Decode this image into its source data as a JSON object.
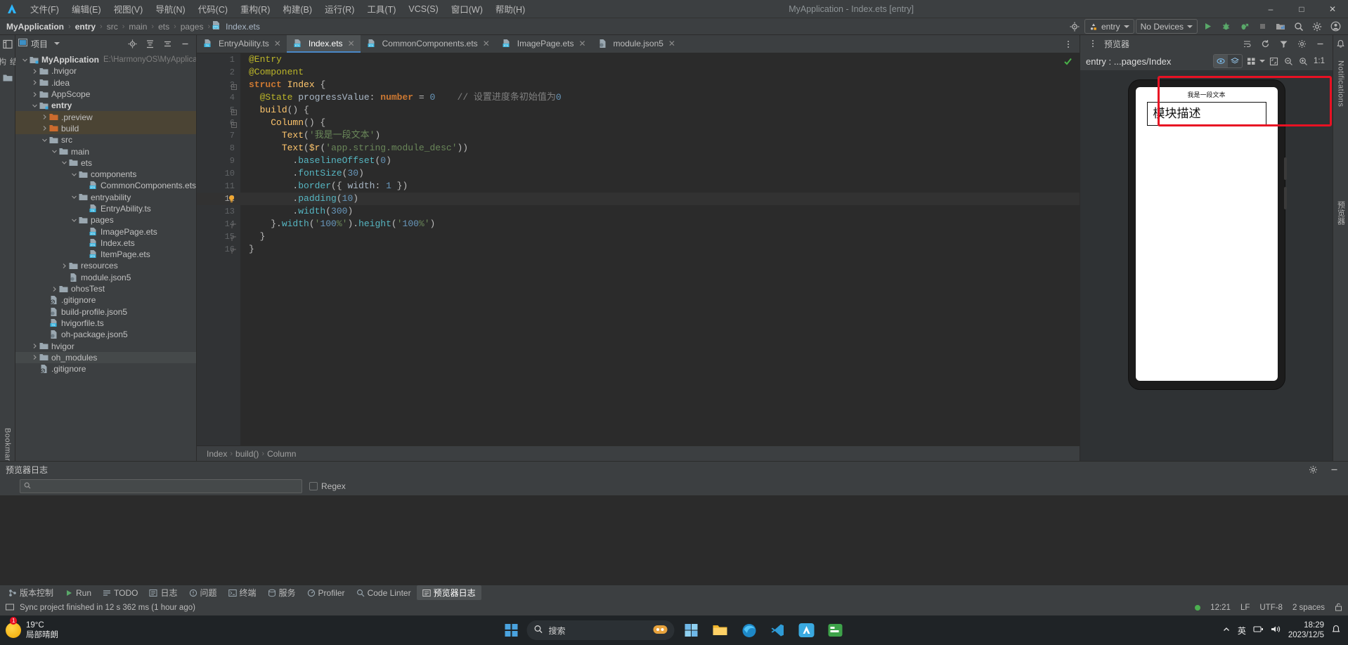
{
  "window": {
    "title": "MyApplication - Index.ets [entry]",
    "minimize": "–",
    "maximize": "□",
    "close": "✕"
  },
  "menubar": {
    "logo_icon": "deveco-logo-icon",
    "items": [
      {
        "label": "文件(F)"
      },
      {
        "label": "编辑(E)"
      },
      {
        "label": "视图(V)"
      },
      {
        "label": "导航(N)"
      },
      {
        "label": "代码(C)"
      },
      {
        "label": "重构(R)"
      },
      {
        "label": "构建(B)"
      },
      {
        "label": "运行(R)"
      },
      {
        "label": "工具(T)"
      },
      {
        "label": "VCS(S)"
      },
      {
        "label": "窗口(W)"
      },
      {
        "label": "帮助(H)"
      }
    ]
  },
  "breadcrumb": {
    "items": [
      "MyApplication",
      "entry",
      "src",
      "main",
      "ets",
      "pages",
      "Index.ets"
    ],
    "separator": "›"
  },
  "navtoolbar": {
    "target_icon": "target-icon",
    "run_config": "entry",
    "device": "No Devices",
    "run_icon": "run-icon",
    "debug_icon": "debug-icon",
    "profile_icon": "run-with-profiler-icon",
    "stop_icon": "stop-icon",
    "device_manager_icon": "device-manager-icon",
    "search_icon": "search-icon",
    "settings_icon": "gear-icon",
    "account_icon": "account-icon"
  },
  "leftstrip": {
    "structure_label": "结构",
    "bookmarks_label": "Bookmarks"
  },
  "project": {
    "panel_title": "项目",
    "dropdown_icon": "chevron-down-icon",
    "locate_icon": "locate-file-icon",
    "expand_icon": "expand-all-icon",
    "collapse_icon": "collapse-all-icon",
    "hide_icon": "hide-panel-icon",
    "root_path": "E:\\HarmonyOS\\MyApplicatio",
    "tree": [
      {
        "label": "MyApplication",
        "depth": 0,
        "arrow": "down",
        "icon": "module-folder",
        "bold": true,
        "path": true
      },
      {
        "label": ".hvigor",
        "depth": 1,
        "arrow": "right",
        "icon": "folder"
      },
      {
        "label": ".idea",
        "depth": 1,
        "arrow": "right",
        "icon": "folder"
      },
      {
        "label": "AppScope",
        "depth": 1,
        "arrow": "right",
        "icon": "folder"
      },
      {
        "label": "entry",
        "depth": 1,
        "arrow": "down",
        "icon": "module-folder",
        "bold": true
      },
      {
        "label": ".preview",
        "depth": 2,
        "arrow": "right",
        "icon": "folder-orange",
        "hl": true
      },
      {
        "label": "build",
        "depth": 2,
        "arrow": "right",
        "icon": "folder-orange",
        "hl": true
      },
      {
        "label": "src",
        "depth": 2,
        "arrow": "down",
        "icon": "folder"
      },
      {
        "label": "main",
        "depth": 3,
        "arrow": "down",
        "icon": "folder"
      },
      {
        "label": "ets",
        "depth": 4,
        "arrow": "down",
        "icon": "folder"
      },
      {
        "label": "components",
        "depth": 5,
        "arrow": "down",
        "icon": "folder"
      },
      {
        "label": "CommonComponents.ets",
        "depth": 6,
        "arrow": "none",
        "icon": "ets-file"
      },
      {
        "label": "entryability",
        "depth": 5,
        "arrow": "down",
        "icon": "folder"
      },
      {
        "label": "EntryAbility.ts",
        "depth": 6,
        "arrow": "none",
        "icon": "ts-file"
      },
      {
        "label": "pages",
        "depth": 5,
        "arrow": "down",
        "icon": "folder"
      },
      {
        "label": "ImagePage.ets",
        "depth": 6,
        "arrow": "none",
        "icon": "ets-file"
      },
      {
        "label": "Index.ets",
        "depth": 6,
        "arrow": "none",
        "icon": "ets-file"
      },
      {
        "label": "ItemPage.ets",
        "depth": 6,
        "arrow": "none",
        "icon": "ets-file"
      },
      {
        "label": "resources",
        "depth": 4,
        "arrow": "right",
        "icon": "folder"
      },
      {
        "label": "module.json5",
        "depth": 4,
        "arrow": "none",
        "icon": "json-file"
      },
      {
        "label": "ohosTest",
        "depth": 3,
        "arrow": "right",
        "icon": "folder"
      },
      {
        "label": ".gitignore",
        "depth": 2,
        "arrow": "none",
        "icon": "gitignore-file"
      },
      {
        "label": "build-profile.json5",
        "depth": 2,
        "arrow": "none",
        "icon": "json-file"
      },
      {
        "label": "hvigorfile.ts",
        "depth": 2,
        "arrow": "none",
        "icon": "ts-file"
      },
      {
        "label": "oh-package.json5",
        "depth": 2,
        "arrow": "none",
        "icon": "json-file"
      },
      {
        "label": "hvigor",
        "depth": 1,
        "arrow": "right",
        "icon": "folder"
      },
      {
        "label": "oh_modules",
        "depth": 1,
        "arrow": "right",
        "icon": "folder",
        "hl2": true
      },
      {
        "label": ".gitignore",
        "depth": 1,
        "arrow": "none",
        "icon": "gitignore-file"
      }
    ]
  },
  "editor": {
    "tabs": [
      {
        "label": "EntryAbility.ts",
        "icon": "ts-file",
        "active": false
      },
      {
        "label": "Index.ets",
        "icon": "ets-file",
        "active": true
      },
      {
        "label": "CommonComponents.ets",
        "icon": "ets-file",
        "active": false
      },
      {
        "label": "ImagePage.ets",
        "icon": "ets-file",
        "active": false
      },
      {
        "label": "module.json5",
        "icon": "json-file",
        "active": false
      }
    ],
    "tab_close": "✕",
    "more_icon": "more-options-icon",
    "inspection_status_icon": "check-ok-icon",
    "current_line": 12,
    "bulb_icon": "intention-bulb-icon",
    "lines": [
      {
        "n": 1,
        "text": "@Entry"
      },
      {
        "n": 2,
        "text": "@Component"
      },
      {
        "n": 3,
        "text": "struct Index {"
      },
      {
        "n": 4,
        "text": "  @State progressValue: number = 0    // 设置进度条初始值为0"
      },
      {
        "n": 5,
        "text": "  build() {"
      },
      {
        "n": 6,
        "text": "    Column() {"
      },
      {
        "n": 7,
        "text": "      Text('我是一段文本')"
      },
      {
        "n": 8,
        "text": "      Text($r('app.string.module_desc'))"
      },
      {
        "n": 9,
        "text": "        .baselineOffset(0)"
      },
      {
        "n": 10,
        "text": "        .fontSize(30)"
      },
      {
        "n": 11,
        "text": "        .border({ width: 1 })"
      },
      {
        "n": 12,
        "text": "        .padding(10)"
      },
      {
        "n": 13,
        "text": "        .width(300)"
      },
      {
        "n": 14,
        "text": "    }.width('100%').height('100%')"
      },
      {
        "n": 15,
        "text": "  }"
      },
      {
        "n": 16,
        "text": "}"
      }
    ],
    "status_breadcrumb": [
      "Index",
      "build()",
      "Column"
    ],
    "status_breadcrumb_sep": "›"
  },
  "preview": {
    "panel_title": "预览器",
    "more_icon": "more-options-icon",
    "route_label": "entry : ...pages/Index",
    "inspector_icon": "inspector-icon",
    "layers_icon": "layers-icon",
    "grid_icon": "multi-device-icon",
    "dropdown_icon": "chevron-down-icon",
    "rotate_icon": "rotate-icon",
    "zoom_out_icon": "zoom-out-icon",
    "zoom_in_icon": "zoom-in-icon",
    "fit_icon": "fit-screen-icon",
    "zoom_level": "1:1",
    "device_text_small": "我是一段文本",
    "device_text_box": "模块描述",
    "highlight_color": "#e81123"
  },
  "logpanel": {
    "title": "预览器日志",
    "settings_icon": "gear-icon",
    "hide_icon": "hide-panel-icon",
    "search_placeholder": "",
    "search_value": "",
    "search_icon": "search-icon",
    "regex_label": "Regex",
    "regex_checked": false
  },
  "toolwindows": [
    {
      "label": "版本控制",
      "icon": "vcs-icon"
    },
    {
      "label": "Run",
      "icon": "run-icon"
    },
    {
      "label": "TODO",
      "icon": "todo-icon"
    },
    {
      "label": "日志",
      "icon": "log-icon"
    },
    {
      "label": "问题",
      "icon": "problems-icon"
    },
    {
      "label": "终端",
      "icon": "terminal-icon"
    },
    {
      "label": "服务",
      "icon": "services-icon"
    },
    {
      "label": "Profiler",
      "icon": "profiler-icon"
    },
    {
      "label": "Code Linter",
      "icon": "code-linter-icon"
    },
    {
      "label": "预览器日志",
      "icon": "previewer-log-icon",
      "active": true
    }
  ],
  "statusbar": {
    "message": "Sync project finished in 12 s 362 ms (1 hour ago)",
    "event_icon": "event-log-icon",
    "line_col": "12:21",
    "line_sep": "LF",
    "encoding": "UTF-8",
    "indent": "2 spaces",
    "lock_icon": "unlocked-icon",
    "status_ok_icon": "green-dot-icon"
  },
  "rightstrip": {
    "notifications_label": "Notifications",
    "previewer_label": "预览器"
  },
  "taskbar": {
    "weather_temp": "19°C",
    "weather_desc": "局部晴朗",
    "start_icon": "windows-start-icon",
    "search_placeholder": "搜索",
    "search_icon": "search-icon",
    "apps": [
      {
        "icon": "widgets-icon"
      },
      {
        "icon": "file-explorer-icon"
      },
      {
        "icon": "edge-icon"
      },
      {
        "icon": "vscode-icon"
      },
      {
        "icon": "deveco-icon"
      },
      {
        "icon": "other-app-icon"
      }
    ],
    "clock_time": "18:29",
    "clock_date": "2023/12/5",
    "ime_label": "英",
    "notification_badge": "1",
    "chevron_up_icon": "chevron-up-icon",
    "network_icon": "network-icon",
    "volume_icon": "volume-icon",
    "notification_icon": "notification-icon"
  }
}
